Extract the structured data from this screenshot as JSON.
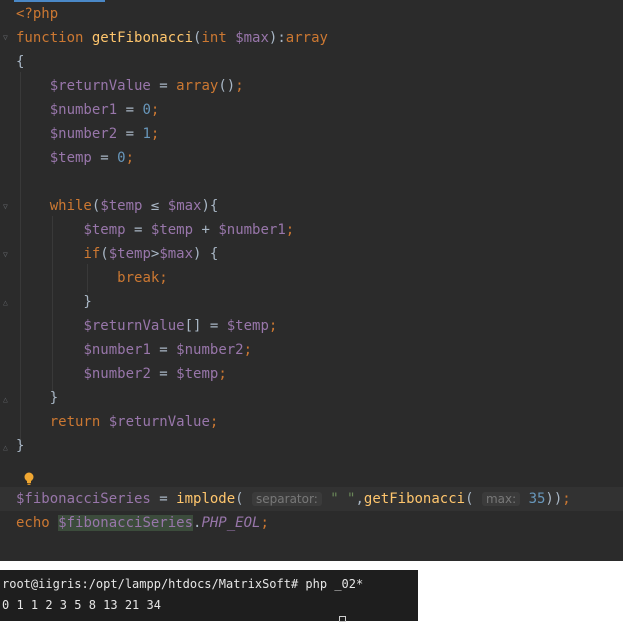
{
  "editor": {
    "lines": [
      {
        "text": "<?php"
      },
      {
        "text": "function getFibonacci(int $max):array"
      },
      {
        "text": "{"
      },
      {
        "text": "    $returnValue = array();"
      },
      {
        "text": "    $number1 = 0;"
      },
      {
        "text": "    $number2 = 1;"
      },
      {
        "text": "    $temp = 0;"
      },
      {
        "text": ""
      },
      {
        "text": "    while($temp ≤ $max){"
      },
      {
        "text": "        $temp = $temp + $number1;"
      },
      {
        "text": "        if($temp>$max) {"
      },
      {
        "text": "            break;"
      },
      {
        "text": "        }"
      },
      {
        "text": "        $returnValue[] = $temp;"
      },
      {
        "text": "        $number1 = $number2;"
      },
      {
        "text": "        $number2 = $temp;"
      },
      {
        "text": "    }"
      },
      {
        "text": "    return $returnValue;"
      },
      {
        "text": "}"
      },
      {
        "text": ""
      },
      {
        "text": "$fibonacciSeries = implode( separator: \" \",getFibonacci( max: 35));"
      },
      {
        "text": "echo $fibonacciSeries.PHP_EOL;"
      }
    ],
    "hints": {
      "separator": "separator:",
      "max": "max:"
    }
  },
  "terminal": {
    "prompt": "root@iigris:/opt/lampp/htdocs/MatrixSoft# php _02*",
    "output": "0 1 1 2 3 5 8 13 21 34"
  },
  "colors": {
    "background": "#2b2b2b",
    "keyword": "#cc7832",
    "function": "#ffc66d",
    "variable": "#9876aa",
    "number": "#6897bb",
    "string": "#6a8759"
  },
  "icons": {
    "bulb": "lightbulb-icon",
    "fold": "fold-marker-icon"
  }
}
